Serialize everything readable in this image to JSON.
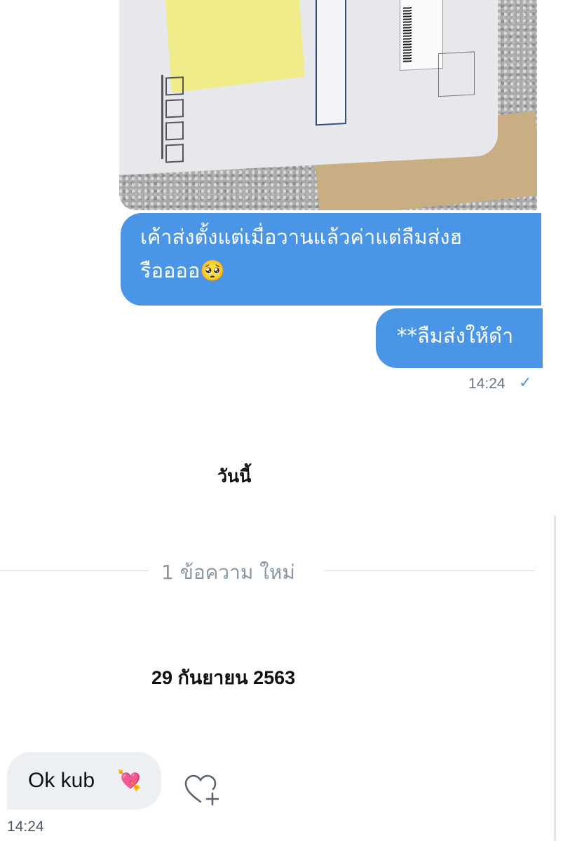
{
  "messages": [
    {
      "type": "image",
      "icon": "package-photo"
    },
    {
      "type": "sent",
      "text_line1": "เค้าส่งตั้งแต่เมื่อวานแล้วค่าแต่ลืมส่งฮ",
      "text_line2": "รืออออ🥺"
    },
    {
      "type": "sent",
      "text": "**ลืมส่งให้ดำ"
    }
  ],
  "sent_time": "14:24",
  "sent_status_icon": "check-icon",
  "day_label": "วันนี้",
  "new_messages_label": "1 ข้อความ ใหม่",
  "date_label": "29 กันยายน 2563",
  "received": {
    "text": "Ok kub",
    "emoji": "💘",
    "time": "14:24"
  },
  "colors": {
    "sent_bubble": "#4a95e6",
    "received_bubble": "#edf0f2",
    "divider_text": "#8a97a3"
  }
}
